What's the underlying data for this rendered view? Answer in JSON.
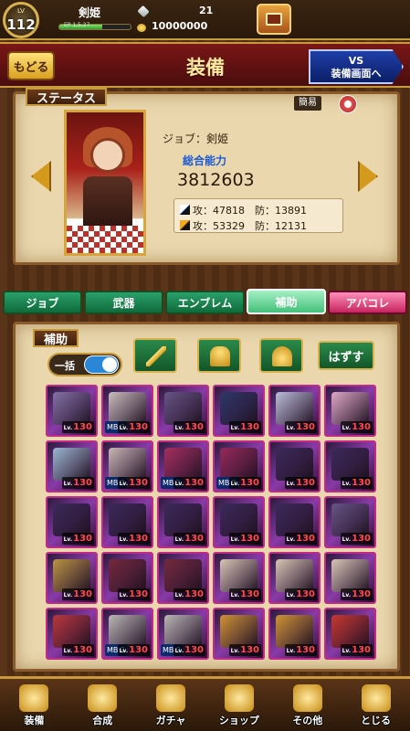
{
  "player": {
    "lv_label": "LV",
    "level": "112",
    "name": "剣姫",
    "exp_label": "EP 1,5,27",
    "exp_fraction": 0.6,
    "gems": "21",
    "gold": "10000000"
  },
  "header": {
    "back_label": "もどる",
    "title": "装備",
    "vs_line1": "VS",
    "vs_line2": "装備画面へ"
  },
  "status": {
    "tag": "ステータス",
    "simple_label": "簡易",
    "job": "ジョブ：剣姫",
    "power_label": "総合能力",
    "power_value": "3812603",
    "row1": "攻：47818　防：13891",
    "row2": "攻：53329　防：12131"
  },
  "tabs": [
    {
      "label": "ジョブ"
    },
    {
      "label": "武器"
    },
    {
      "label": "エンブレム"
    },
    {
      "label": "補助"
    },
    {
      "label": "アバコレ"
    }
  ],
  "equip": {
    "tag": "補助",
    "bulk_label": "一括",
    "remove_label": "はずす"
  },
  "cards": [
    {
      "lv": "130",
      "mb": "",
      "art": "#8a7ab0"
    },
    {
      "lv": "130",
      "mb": "MB 2",
      "art": "#d8d0c8"
    },
    {
      "lv": "130",
      "mb": "",
      "art": "#6a5a8a"
    },
    {
      "lv": "130",
      "mb": "",
      "art": "#2a3a6a"
    },
    {
      "lv": "130",
      "mb": "",
      "art": "#c8d0e8"
    },
    {
      "lv": "130",
      "mb": "",
      "art": "#f0b8d0"
    },
    {
      "lv": "130",
      "mb": "",
      "art": "#a8c8e0"
    },
    {
      "lv": "130",
      "mb": "MB 2",
      "art": "#d8c8c0"
    },
    {
      "lv": "130",
      "mb": "MB 2",
      "art": "#b03060"
    },
    {
      "lv": "130",
      "mb": "MB 2",
      "art": "#a02a5a"
    },
    {
      "lv": "130",
      "mb": "",
      "art": "#3a2a5a"
    },
    {
      "lv": "130",
      "mb": "",
      "art": "#3a2a5a"
    },
    {
      "lv": "130",
      "mb": "",
      "art": "#3a2a5a"
    },
    {
      "lv": "130",
      "mb": "",
      "art": "#3a2a5a"
    },
    {
      "lv": "130",
      "mb": "",
      "art": "#3a2a5a"
    },
    {
      "lv": "130",
      "mb": "",
      "art": "#3a2a5a"
    },
    {
      "lv": "130",
      "mb": "",
      "art": "#3a2a5a"
    },
    {
      "lv": "130",
      "mb": "",
      "art": "#6a5a8a"
    },
    {
      "lv": "130",
      "mb": "",
      "art": "#c8a040"
    },
    {
      "lv": "130",
      "mb": "",
      "art": "#7a2a3a"
    },
    {
      "lv": "130",
      "mb": "",
      "art": "#7a2a3a"
    },
    {
      "lv": "130",
      "mb": "",
      "art": "#e8d8c0"
    },
    {
      "lv": "130",
      "mb": "",
      "art": "#e8d8c0"
    },
    {
      "lv": "130",
      "mb": "",
      "art": "#e8d8c0"
    },
    {
      "lv": "130",
      "mb": "",
      "art": "#c83a3a"
    },
    {
      "lv": "130",
      "mb": "MB 2",
      "art": "#c8c8c0"
    },
    {
      "lv": "130",
      "mb": "MB 2",
      "art": "#c8c8c0"
    },
    {
      "lv": "130",
      "mb": "",
      "art": "#e0a030"
    },
    {
      "lv": "130",
      "mb": "",
      "art": "#e0a030"
    },
    {
      "lv": "130",
      "mb": "",
      "art": "#d83a2a"
    }
  ],
  "nav": [
    {
      "label": "装備"
    },
    {
      "label": "合成"
    },
    {
      "label": "ガチャ"
    },
    {
      "label": "ショップ"
    },
    {
      "label": "その他"
    },
    {
      "label": "とじる"
    }
  ]
}
